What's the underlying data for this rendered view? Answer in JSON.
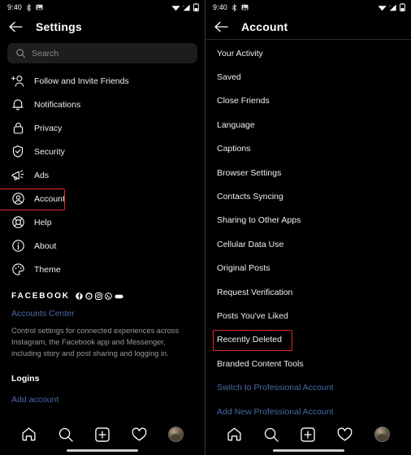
{
  "status_bar": {
    "time": "9:40",
    "left_icons": [
      "bluetooth-icon",
      "screenshot-icon"
    ],
    "right_icons": [
      "wifi-icon",
      "cellular-signal-icon",
      "battery-icon"
    ]
  },
  "settings_screen": {
    "back_icon": "back-arrow-icon",
    "title": "Settings",
    "search": {
      "placeholder": "Search",
      "icon": "search-icon",
      "value": ""
    },
    "items": [
      {
        "label": "Follow and Invite Friends",
        "icon": "add-person-icon",
        "highlighted": false
      },
      {
        "label": "Notifications",
        "icon": "bell-icon",
        "highlighted": false
      },
      {
        "label": "Privacy",
        "icon": "lock-icon",
        "highlighted": false
      },
      {
        "label": "Security",
        "icon": "shield-check-icon",
        "highlighted": false
      },
      {
        "label": "Ads",
        "icon": "megaphone-icon",
        "highlighted": false
      },
      {
        "label": "Account",
        "icon": "person-circle-icon",
        "highlighted": true
      },
      {
        "label": "Help",
        "icon": "life-ring-icon",
        "highlighted": false
      },
      {
        "label": "About",
        "icon": "info-circle-icon",
        "highlighted": false
      },
      {
        "label": "Theme",
        "icon": "palette-icon",
        "highlighted": false
      }
    ],
    "facebook_section": {
      "heading": "FACEBOOK",
      "brand_icons": [
        "facebook-icon",
        "messenger-icon",
        "instagram-icon",
        "whatsapp-icon",
        "portal-icon"
      ],
      "link": "Accounts Center",
      "description": "Control settings for connected experiences across Instagram, the Facebook app and Messenger, including story and post sharing and logging in."
    },
    "logins_heading": "Logins",
    "add_account_link": "Add account"
  },
  "account_screen": {
    "back_icon": "back-arrow-icon",
    "title": "Account",
    "items": [
      {
        "label": "Your Activity",
        "type": "normal",
        "highlighted": false
      },
      {
        "label": "Saved",
        "type": "normal",
        "highlighted": false
      },
      {
        "label": "Close Friends",
        "type": "normal",
        "highlighted": false
      },
      {
        "label": "Language",
        "type": "normal",
        "highlighted": false
      },
      {
        "label": "Captions",
        "type": "normal",
        "highlighted": false
      },
      {
        "label": "Browser Settings",
        "type": "normal",
        "highlighted": false
      },
      {
        "label": "Contacts Syncing",
        "type": "normal",
        "highlighted": false
      },
      {
        "label": "Sharing to Other Apps",
        "type": "normal",
        "highlighted": false
      },
      {
        "label": "Cellular Data Use",
        "type": "normal",
        "highlighted": false
      },
      {
        "label": "Original Posts",
        "type": "normal",
        "highlighted": false
      },
      {
        "label": "Request Verification",
        "type": "normal",
        "highlighted": false
      },
      {
        "label": "Posts You've Liked",
        "type": "normal",
        "highlighted": false
      },
      {
        "label": "Recently Deleted",
        "type": "normal",
        "highlighted": true
      },
      {
        "label": "Branded Content Tools",
        "type": "normal",
        "highlighted": false
      },
      {
        "label": "Switch to Professional Account",
        "type": "link",
        "highlighted": false
      },
      {
        "label": "Add New Professional Account",
        "type": "link",
        "highlighted": false
      }
    ]
  },
  "bottom_nav": {
    "items": [
      "home-icon",
      "search-icon",
      "add-post-icon",
      "activity-heart-icon",
      "profile-avatar"
    ]
  },
  "colors": {
    "background": "#000000",
    "text_primary": "#efefef",
    "text_secondary": "#9a9a9a",
    "link_blue": "#4a69a8",
    "highlight_red": "#e02a2a",
    "search_field": "#1d1d1d"
  }
}
